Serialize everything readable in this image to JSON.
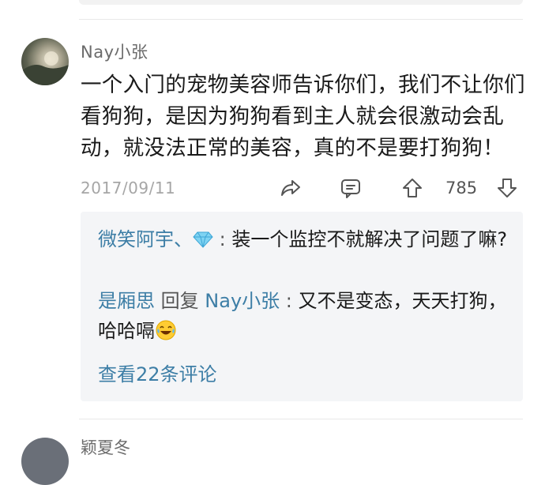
{
  "comment": {
    "username": "Nay小张",
    "text": "一个入门的宠物美容师告诉你们，我们不让你们看狗狗，是因为狗狗看到主人就会很激动会乱动，就没法正常的美容，真的不是要打狗狗！",
    "date": "2017/09/11",
    "like_count": "785"
  },
  "replies": [
    {
      "author": "微笑阿宇、",
      "badge_icon": "diamond-icon",
      "separator": ":",
      "text": "装一个监控不就解决了问题了嘛?"
    },
    {
      "author": "是厢思",
      "reply_word": "回复",
      "reply_to": "Nay小张",
      "separator": ":",
      "text": "又不是变态，天天打狗，哈哈嗝",
      "emoji_icon": "tears-of-joy-icon"
    }
  ],
  "view_more": "查看22条评论",
  "next_comment": {
    "username": "颖夏冬"
  },
  "colors": {
    "link": "#3d7ea6",
    "meta": "#a6a6a6",
    "reply_bg": "#f4f5f7"
  }
}
